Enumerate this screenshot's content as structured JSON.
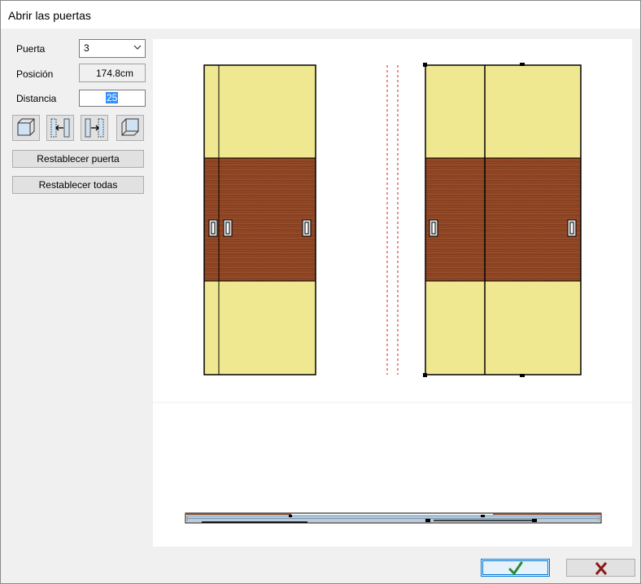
{
  "window": {
    "title": "Abrir las puertas"
  },
  "panel": {
    "puerta_label": "Puerta",
    "puerta_value": "3",
    "posicion_label": "Posición",
    "posicion_value": "174.8cm",
    "distancia_label": "Distancia",
    "distancia_value": "25",
    "icon_buttons": [
      "cube-front-icon",
      "move-left-icon",
      "move-right-icon",
      "cube-back-icon"
    ],
    "reset_door_label": "Restablecer puerta",
    "reset_all_label": "Restablecer todas"
  },
  "footer": {
    "ok_icon": "checkmark-icon",
    "cancel_icon": "close-x-icon",
    "ok_color": "#2e8b2e",
    "cancel_color": "#8b1a1a"
  },
  "colors": {
    "panel_yellow": "#efe891",
    "wood": "#8e4526",
    "guide_red": "#d02020",
    "track_blue": "#a9cfef"
  }
}
